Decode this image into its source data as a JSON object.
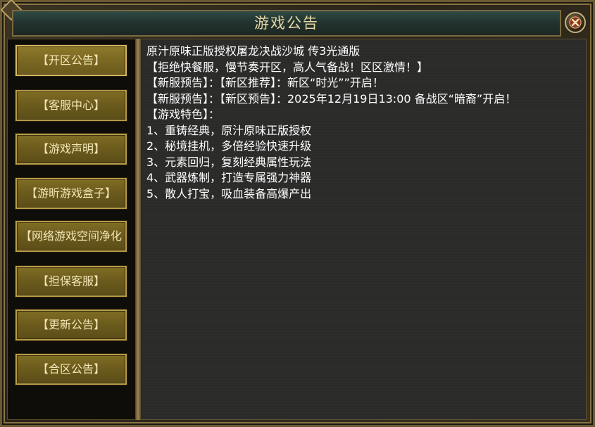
{
  "window": {
    "title": "游戏公告",
    "close_icon": "close-x-icon"
  },
  "sidebar": {
    "items": [
      {
        "label": "【开区公告】",
        "active": true
      },
      {
        "label": "【客服中心】",
        "active": false
      },
      {
        "label": "【游戏声明】",
        "active": false
      },
      {
        "label": "【游昕游戏盒子】",
        "active": false
      },
      {
        "label": "【网络游戏空间净化",
        "active": false
      },
      {
        "label": "【担保客服】",
        "active": false
      },
      {
        "label": "【更新公告】",
        "active": false
      },
      {
        "label": "【合区公告】",
        "active": false
      }
    ]
  },
  "content": {
    "lines": [
      "原汁原味正版授权屠龙决战沙城 传3光通版",
      "【拒绝快餐服，慢节奏开区，高人气备战！区区激情！】",
      "【新服预告】：【新区推荐】：新区“时光””开启！",
      "【新服预告】：【新区预告】：2025年12月19日13:00 备战区“暗裔”开启！",
      "【游戏特色】：",
      "1、重铸经典，原汁原味正版授权",
      "2、秘境挂机，多倍经验快速升级",
      "3、元素回归，复刻经典属性玩法",
      "4、武器炼制，打造专属强力神器",
      "5、散人打宝，吸血装备高爆产出"
    ]
  },
  "colors": {
    "button_face": "#6a5a1c",
    "button_border": "#b79b4a",
    "content_bg": "#2b2b2a",
    "title_text": "#e7d8a6"
  }
}
